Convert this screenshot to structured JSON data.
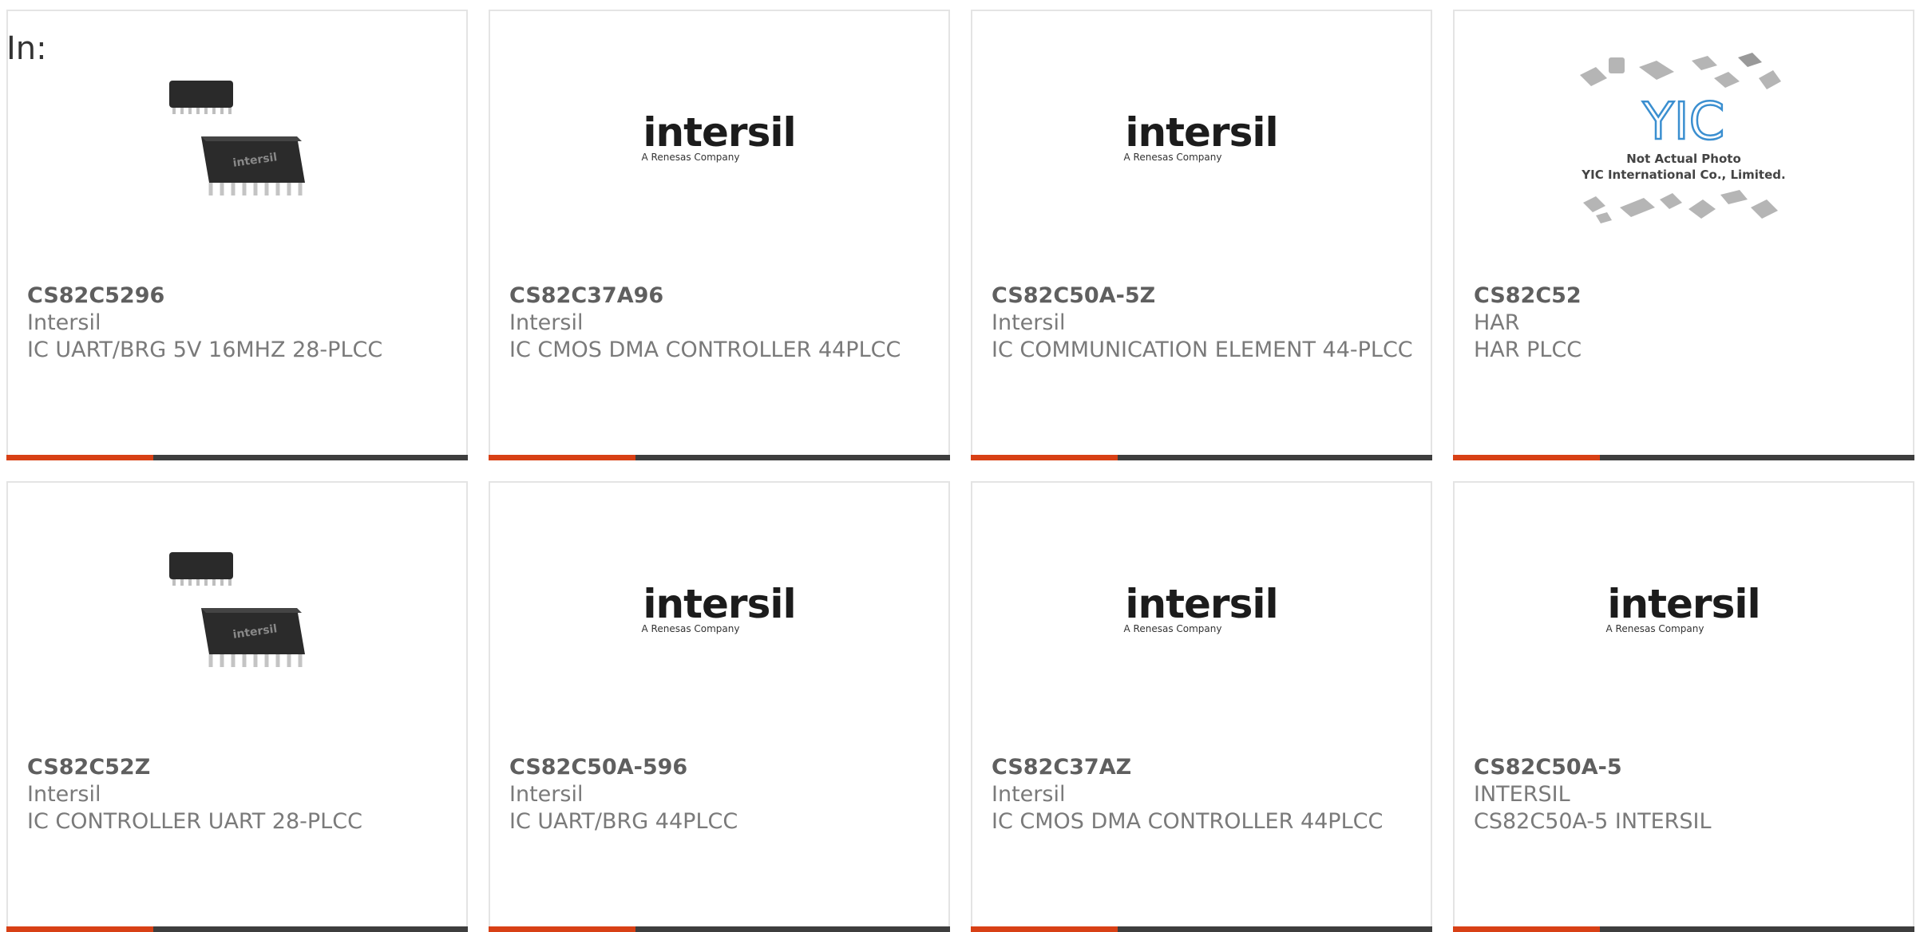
{
  "heading": "In:",
  "colors": {
    "accent": "#d84015",
    "bar": "#3e3e3e",
    "border": "#e4e4e4"
  },
  "products": [
    {
      "part": "CS82C5296",
      "maker": "Intersil",
      "desc": "IC UART/BRG 5V 16MHZ 28-PLCC",
      "image": "chip-photo"
    },
    {
      "part": "CS82C37A96",
      "maker": "Intersil",
      "desc": "IC CMOS DMA CONTROLLER 44PLCC",
      "image": "intersil-logo"
    },
    {
      "part": "CS82C50A-5Z",
      "maker": "Intersil",
      "desc": "IC COMMUNICATION ELEMENT 44-PLCC",
      "image": "intersil-logo"
    },
    {
      "part": "CS82C52",
      "maker": "HAR",
      "desc": "HAR PLCC",
      "image": "yic-placeholder"
    },
    {
      "part": "CS82C52Z",
      "maker": "Intersil",
      "desc": "IC CONTROLLER UART 28-PLCC",
      "image": "chip-photo"
    },
    {
      "part": "CS82C50A-596",
      "maker": "Intersil",
      "desc": "IC UART/BRG 44PLCC",
      "image": "intersil-logo"
    },
    {
      "part": "CS82C37AZ",
      "maker": "Intersil",
      "desc": "IC CMOS DMA CONTROLLER 44PLCC",
      "image": "intersil-logo"
    },
    {
      "part": "CS82C50A-5",
      "maker": "INTERSIL",
      "desc": "CS82C50A-5 INTERSIL",
      "image": "intersil-logo"
    }
  ],
  "logos": {
    "intersil_word": "intersil",
    "intersil_tag": "A Renesas Company",
    "chip_mark": "intersil",
    "yic_mark": "YIC",
    "yic_line1": "Not Actual Photo",
    "yic_line2": "YIC International Co., Limited."
  }
}
